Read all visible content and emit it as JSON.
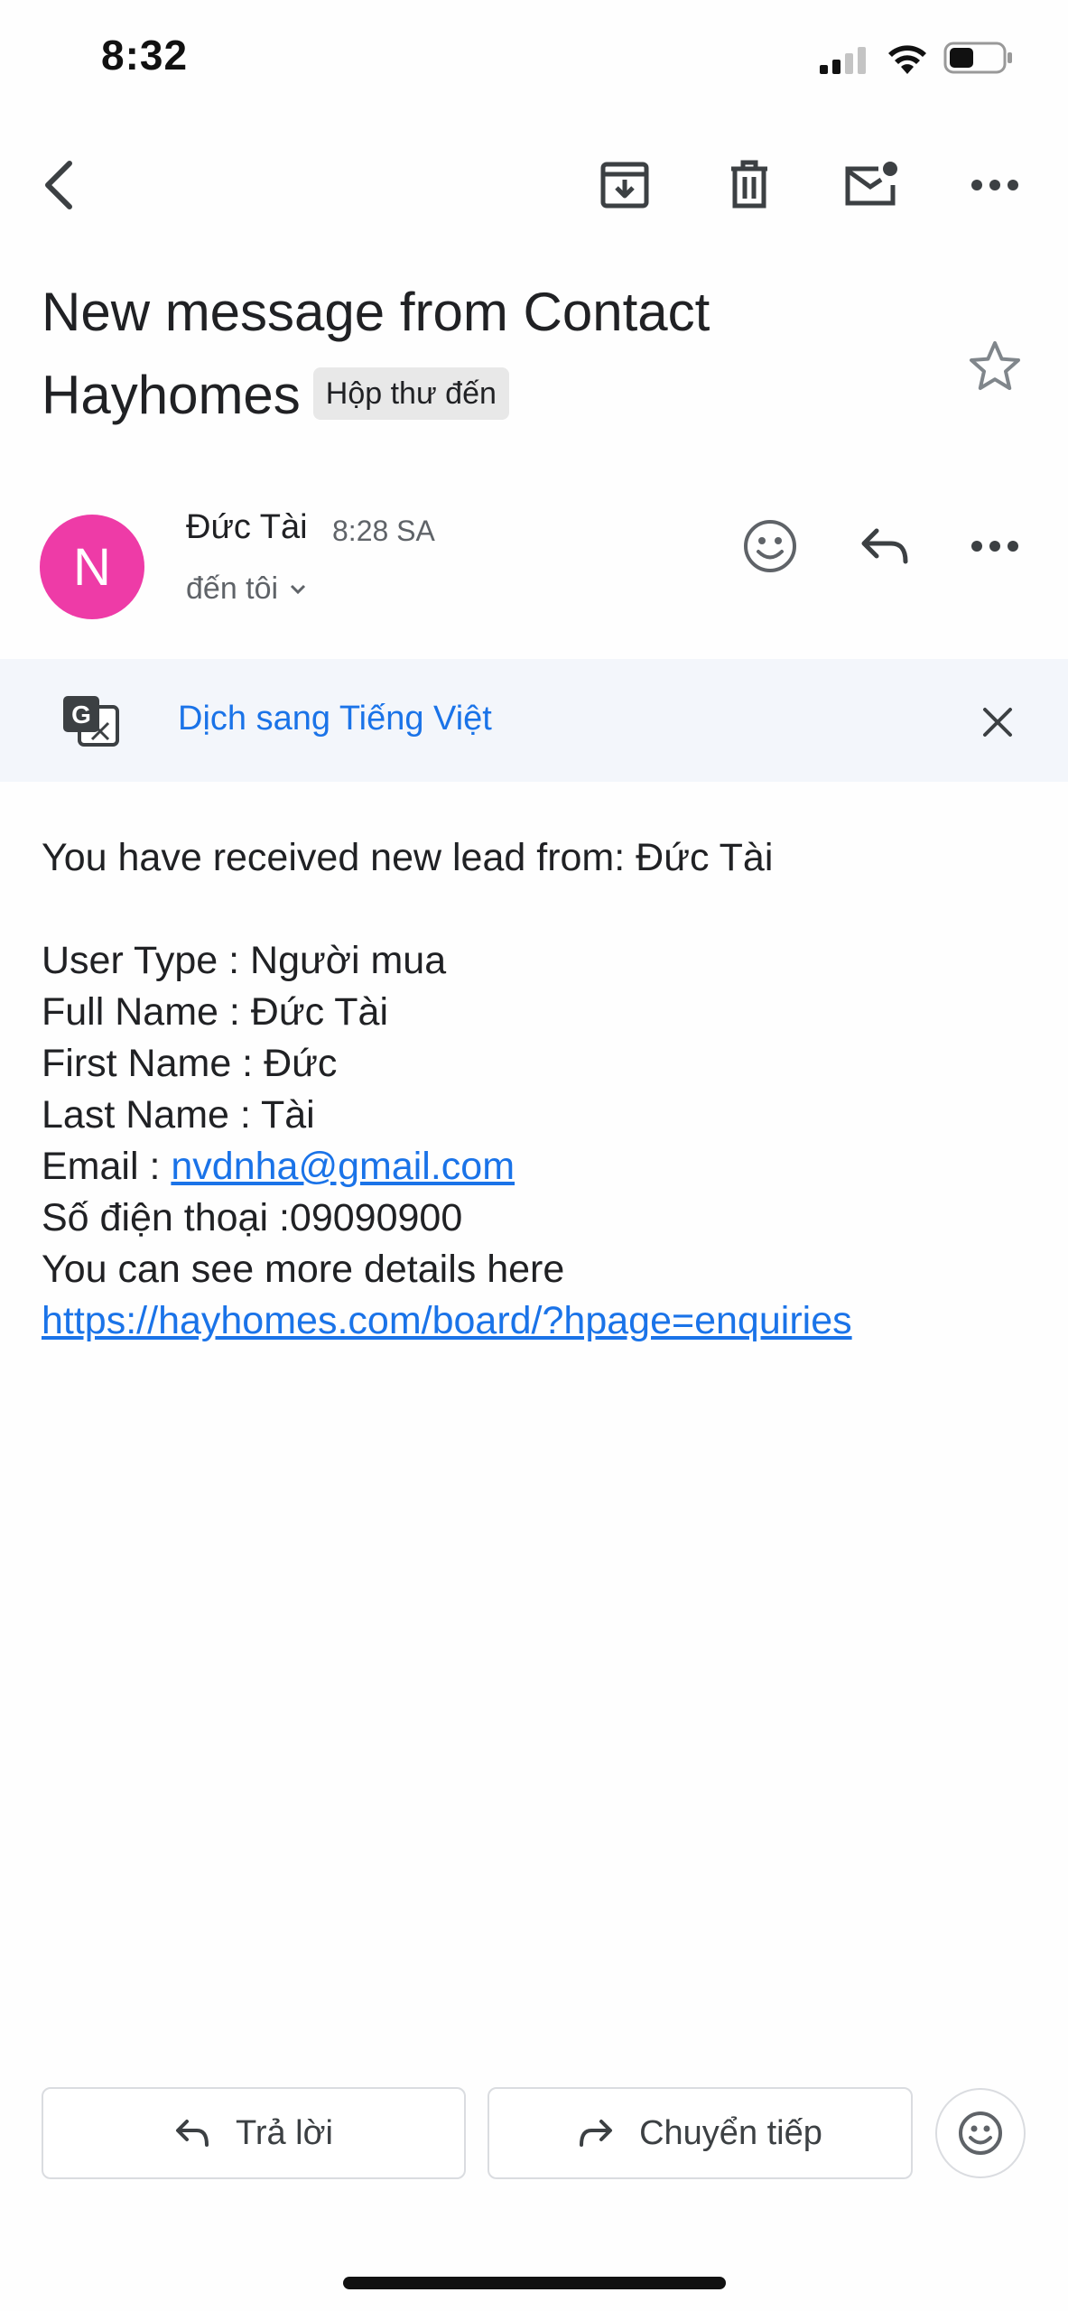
{
  "status_bar": {
    "time": "8:32"
  },
  "toolbar": {
    "back_icon": "back-arrow-icon",
    "archive_icon": "archive-icon",
    "delete_icon": "trash-icon",
    "unread_icon": "mark-unread-icon",
    "more_icon": "more-horizontal-icon"
  },
  "email": {
    "subject": "New message from Contact Hayhomes",
    "label": "Hộp thư đến",
    "starred": false,
    "sender": {
      "avatar_letter": "N",
      "avatar_color": "#ee3ba7",
      "name": "Đức Tài",
      "time": "8:28 SA",
      "recipient": "đến tôi"
    }
  },
  "translate": {
    "label": "Dịch sang Tiếng Việt"
  },
  "body": {
    "intro": "You have received new lead from: Đức Tài",
    "user_type": "User Type : Người mua",
    "full_name": "Full Name : Đức Tài",
    "first_name": "First Name : Đức",
    "last_name": "Last Name : Tài",
    "email_label": "Email : ",
    "email_link": "nvdnha@gmail.com",
    "phone": "Số điện thoại :09090900",
    "details_text": "You can see more details here",
    "details_link": "https://hayhomes.com/board/?hpage=enquiries"
  },
  "actions": {
    "reply": "Trả lời",
    "forward": "Chuyển tiếp"
  },
  "colors": {
    "accent": "#1a73e8",
    "translate_bg": "#f3f6fb"
  }
}
